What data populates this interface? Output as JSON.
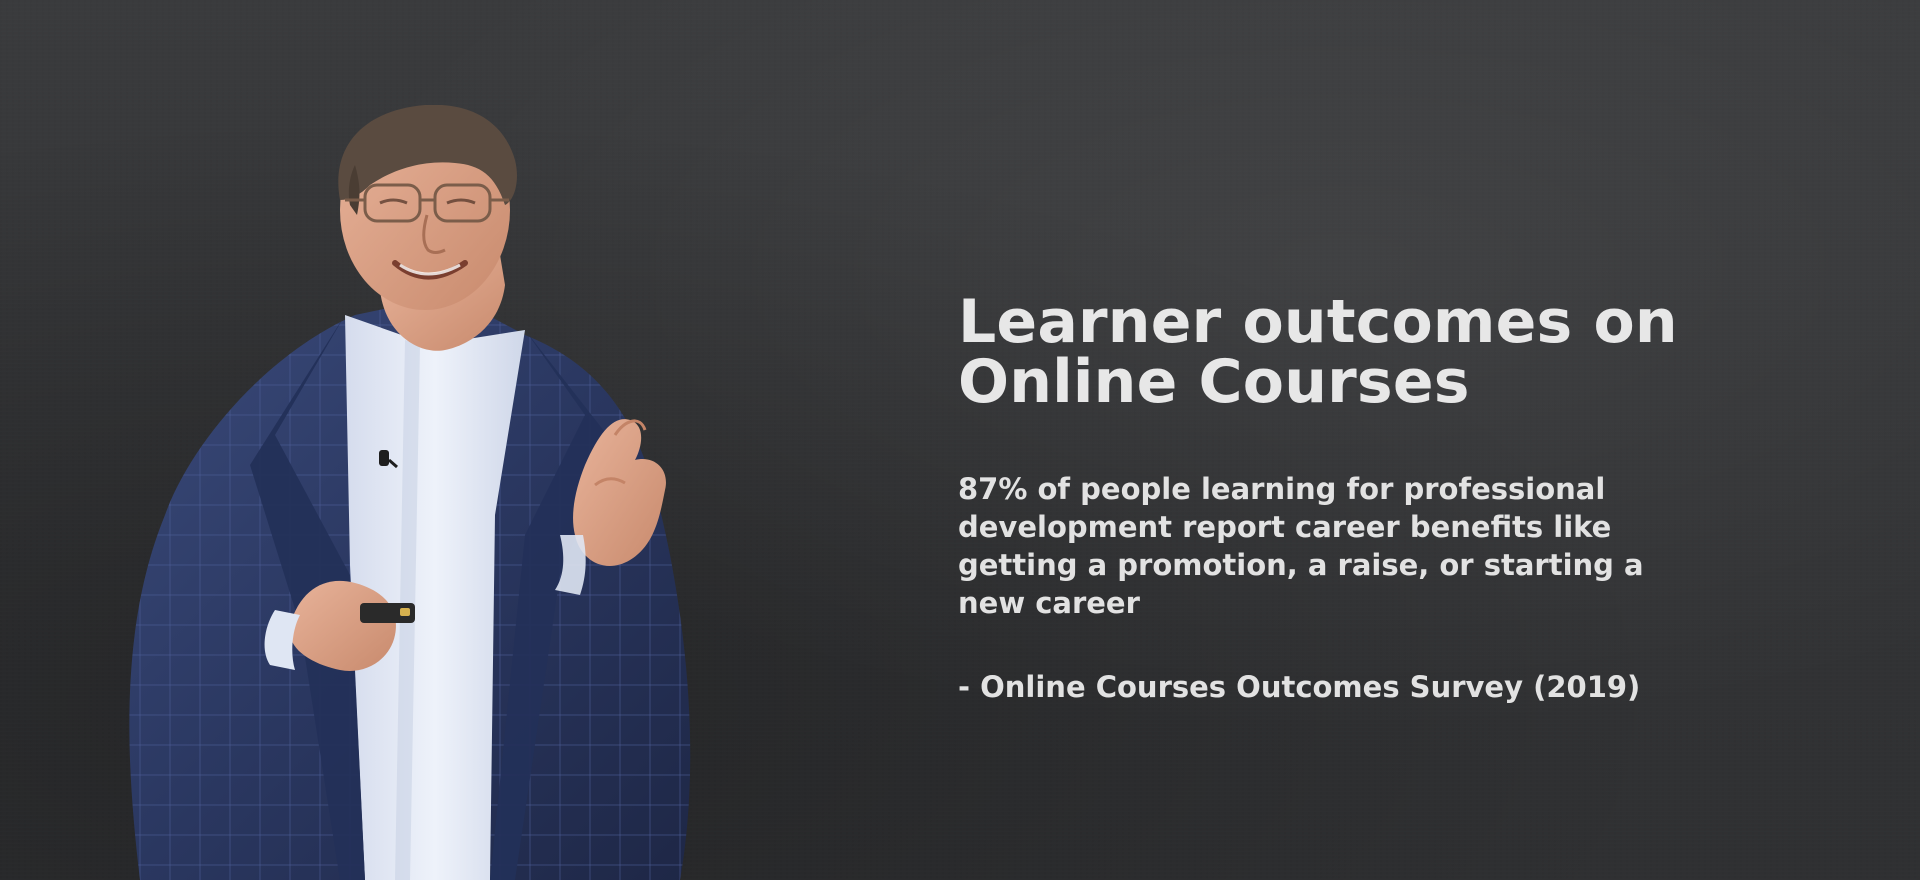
{
  "slide": {
    "headline_line1": "Learner outcomes on",
    "headline_line2": "Online Courses",
    "stat_text": "87% of people learning for professional development report career benefits like getting a promotion, a raise, or starting a new career",
    "source_text": "- Online Courses Outcomes Survey (2019)"
  },
  "colors": {
    "background": "#353638",
    "text": "#e6e6e6",
    "suit": "#2b3a63",
    "shirt": "#dfe6f3"
  },
  "icons": {
    "speaker": "man-in-blue-suit-photo",
    "mic": "lapel-microphone-icon",
    "remote": "presentation-remote-icon"
  }
}
